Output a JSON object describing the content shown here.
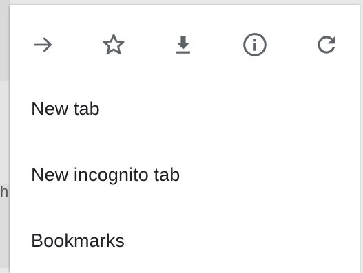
{
  "toolbar": {
    "icons": [
      "forward-arrow-icon",
      "star-icon",
      "download-icon",
      "info-icon",
      "reload-icon"
    ],
    "icon_color": "#5f6368"
  },
  "menu": {
    "items": [
      {
        "label": "New tab"
      },
      {
        "label": "New incognito tab"
      },
      {
        "label": "Bookmarks"
      }
    ],
    "text_color": "#202124",
    "background": "#ffffff"
  },
  "backdrop": {
    "partial_glyph": "h"
  }
}
